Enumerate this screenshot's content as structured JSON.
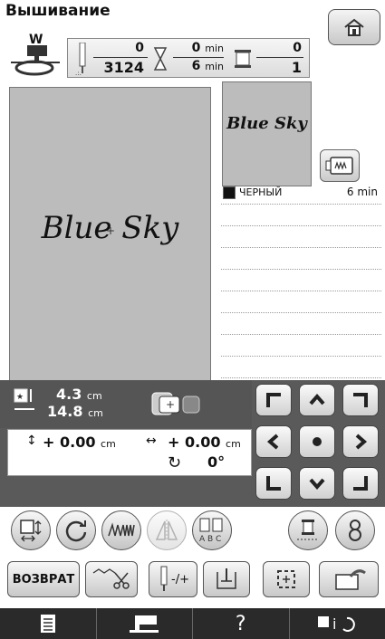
{
  "header": {
    "title": "Вышивание"
  },
  "counter": {
    "stitch_current": "0",
    "stitch_total": "3124",
    "time_current": "0",
    "time_total": "6",
    "time_unit": "min",
    "color_current": "0",
    "color_total": "1"
  },
  "presser_foot": {
    "label": "W"
  },
  "design": {
    "text": "Blue Sky"
  },
  "threads": [
    {
      "name": "ЧЕРНЫЙ",
      "time": "6 min",
      "color": "#111111"
    }
  ],
  "size": {
    "height": "4.3",
    "width": "14.8",
    "unit": "cm"
  },
  "offset": {
    "vertical": "+ 0.00",
    "horizontal": "+ 0.00",
    "unit": "cm",
    "angle": "0°"
  },
  "buttons": {
    "return_label": "ВОЗВРАТ",
    "needle_label": "-/+"
  },
  "bottom": {
    "help": "?"
  }
}
